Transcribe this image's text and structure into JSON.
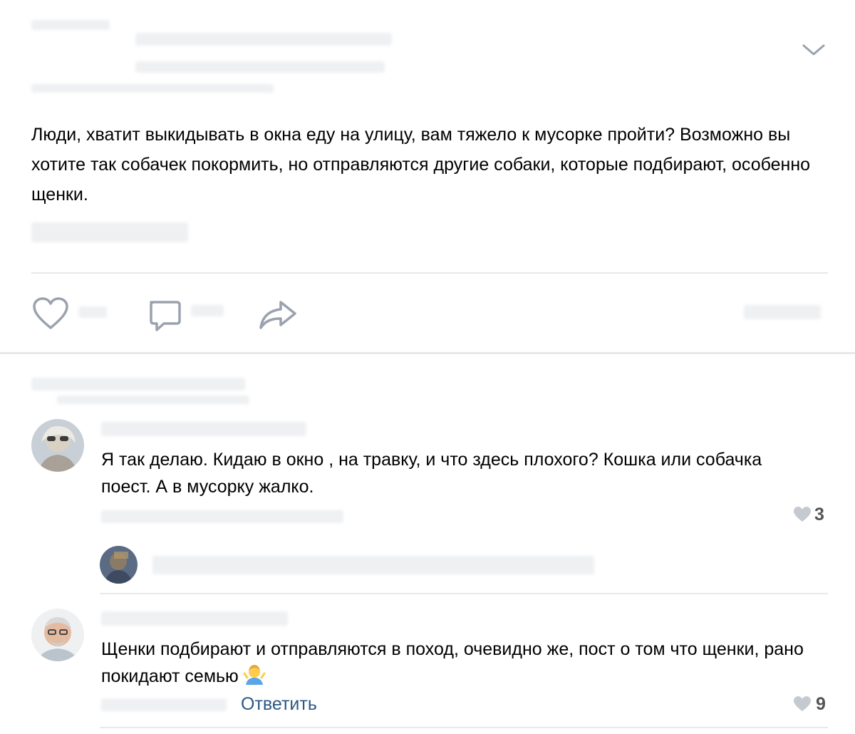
{
  "post": {
    "text": "Люди, хватит выкидывать в окна еду на улицу, вам тяжело к мусорке пройти? Возможно вы хотите так собачек покормить, но отправляются другие собаки, которые подбирают, особенно щенки.",
    "icons": {
      "options": "chevron-down-icon",
      "like": "heart-icon",
      "comment": "comment-icon",
      "share": "share-icon"
    }
  },
  "comments": [
    {
      "text": "Я так делаю. Кидаю в окно , на травку, и что здесь плохого? Кошка или собачка поест. А в мусорку жалко.",
      "likes": "3"
    },
    {
      "text": "Щенки подбирают и отправляются в поход, очевидно же, пост о том что щенки, рано покидают семью",
      "emoji": "🤷",
      "reply_label": "Ответить",
      "likes": "9"
    }
  ],
  "colors": {
    "link": "#2a5885",
    "divider": "#e7e8ec",
    "icon": "#99a2ad"
  }
}
